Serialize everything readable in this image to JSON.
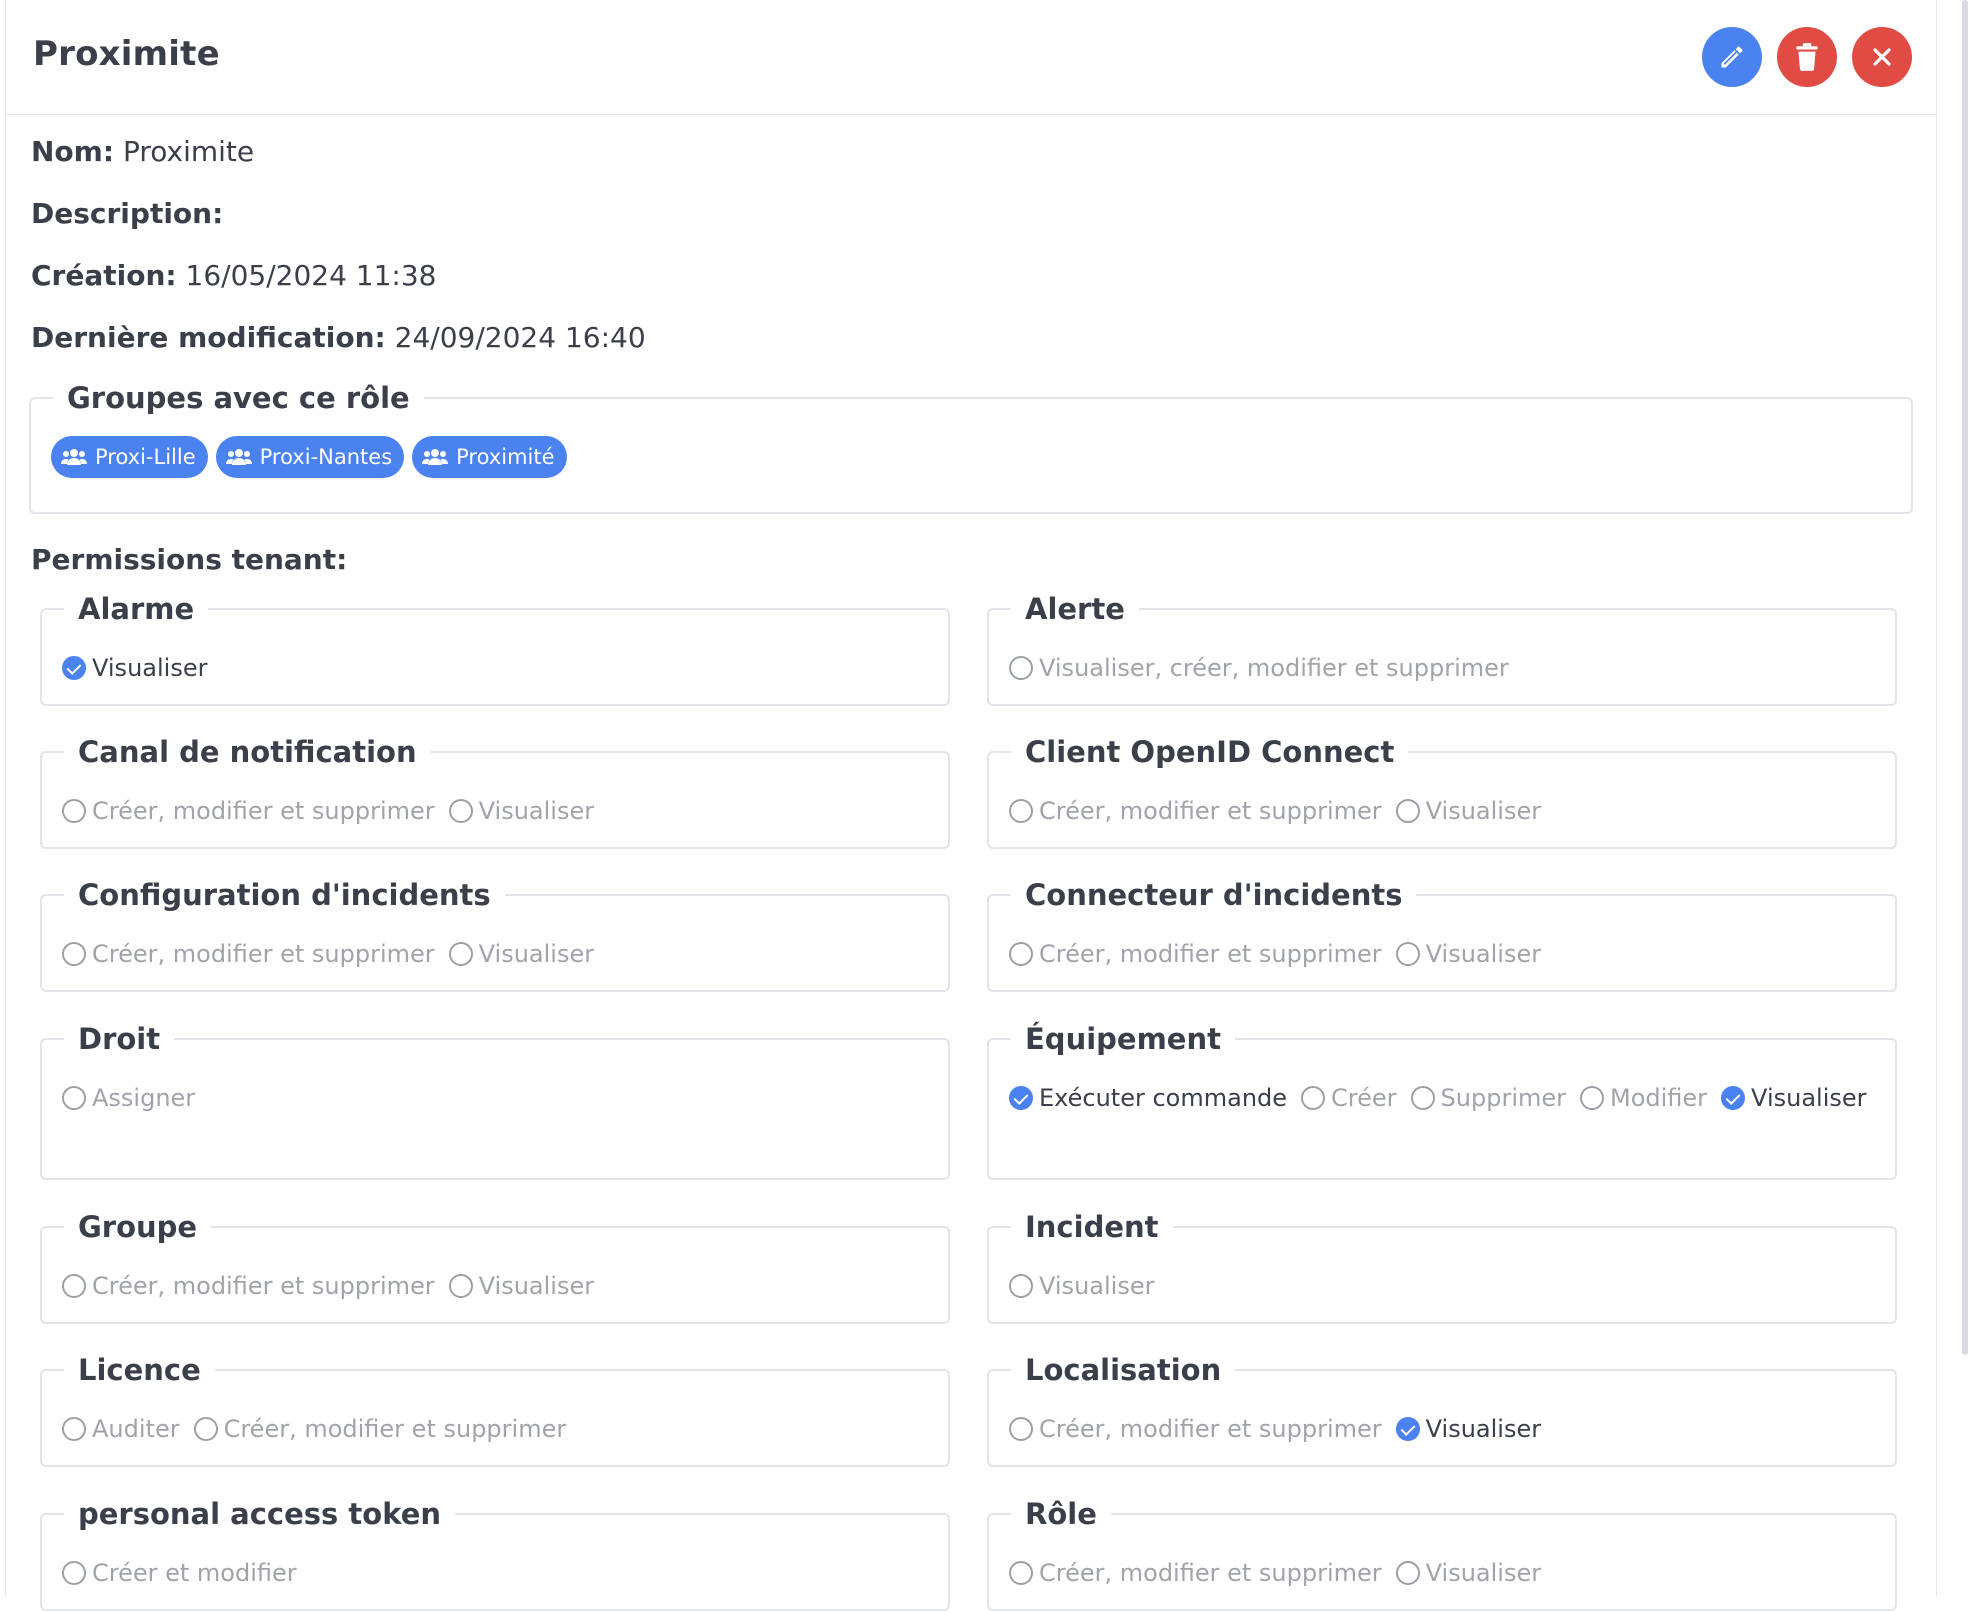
{
  "header": {
    "title": "Proximite"
  },
  "info": {
    "name_label": "Nom:",
    "name_value": "Proximite",
    "description_label": "Description:",
    "description_value": "",
    "created_label": "Création:",
    "created_value": "16/05/2024 11:38",
    "modified_label": "Dernière modification:",
    "modified_value": "24/09/2024 16:40"
  },
  "groups": {
    "legend": "Groupes avec ce rôle",
    "items": [
      "Proxi-Lille",
      "Proxi-Nantes",
      "Proximité"
    ]
  },
  "permissions": {
    "title": "Permissions tenant:",
    "sections": [
      {
        "name": "Alarme",
        "options": [
          {
            "label": "Visualiser",
            "checked": true
          }
        ]
      },
      {
        "name": "Alerte",
        "options": [
          {
            "label": "Visualiser, créer, modifier et supprimer",
            "checked": false
          }
        ]
      },
      {
        "name": "Canal de notification",
        "options": [
          {
            "label": "Créer, modifier et supprimer",
            "checked": false
          },
          {
            "label": "Visualiser",
            "checked": false
          }
        ]
      },
      {
        "name": "Client OpenID Connect",
        "options": [
          {
            "label": "Créer, modifier et supprimer",
            "checked": false
          },
          {
            "label": "Visualiser",
            "checked": false
          }
        ]
      },
      {
        "name": "Configuration d'incidents",
        "options": [
          {
            "label": "Créer, modifier et supprimer",
            "checked": false
          },
          {
            "label": "Visualiser",
            "checked": false
          }
        ]
      },
      {
        "name": "Connecteur d'incidents",
        "options": [
          {
            "label": "Créer, modifier et supprimer",
            "checked": false
          },
          {
            "label": "Visualiser",
            "checked": false
          }
        ]
      },
      {
        "name": "Droit",
        "options": [
          {
            "label": "Assigner",
            "checked": false
          }
        ]
      },
      {
        "name": "Équipement",
        "options": [
          {
            "label": "Exécuter commande",
            "checked": true
          },
          {
            "label": "Créer",
            "checked": false
          },
          {
            "label": "Supprimer",
            "checked": false
          },
          {
            "label": "Modifier",
            "checked": false
          },
          {
            "label": "Visualiser",
            "checked": true
          }
        ]
      },
      {
        "name": "Groupe",
        "options": [
          {
            "label": "Créer, modifier et supprimer",
            "checked": false
          },
          {
            "label": "Visualiser",
            "checked": false
          }
        ]
      },
      {
        "name": "Incident",
        "options": [
          {
            "label": "Visualiser",
            "checked": false
          }
        ]
      },
      {
        "name": "Licence",
        "options": [
          {
            "label": "Auditer",
            "checked": false
          },
          {
            "label": "Créer, modifier et supprimer",
            "checked": false
          }
        ]
      },
      {
        "name": "Localisation",
        "options": [
          {
            "label": "Créer, modifier et supprimer",
            "checked": false
          },
          {
            "label": "Visualiser",
            "checked": true
          }
        ]
      },
      {
        "name": "personal access token",
        "options": [
          {
            "label": "Créer et modifier",
            "checked": false
          }
        ]
      },
      {
        "name": "Rôle",
        "options": [
          {
            "label": "Créer, modifier et supprimer",
            "checked": false
          },
          {
            "label": "Visualiser",
            "checked": false
          }
        ]
      }
    ]
  },
  "colors": {
    "primary": "#4a82f0",
    "danger": "#e04b44",
    "text": "#3a3f4a",
    "muted": "#a0a4aa"
  },
  "icons": {
    "edit": "pencil-icon",
    "delete": "trash-icon",
    "close": "close-icon",
    "group": "users-icon"
  }
}
